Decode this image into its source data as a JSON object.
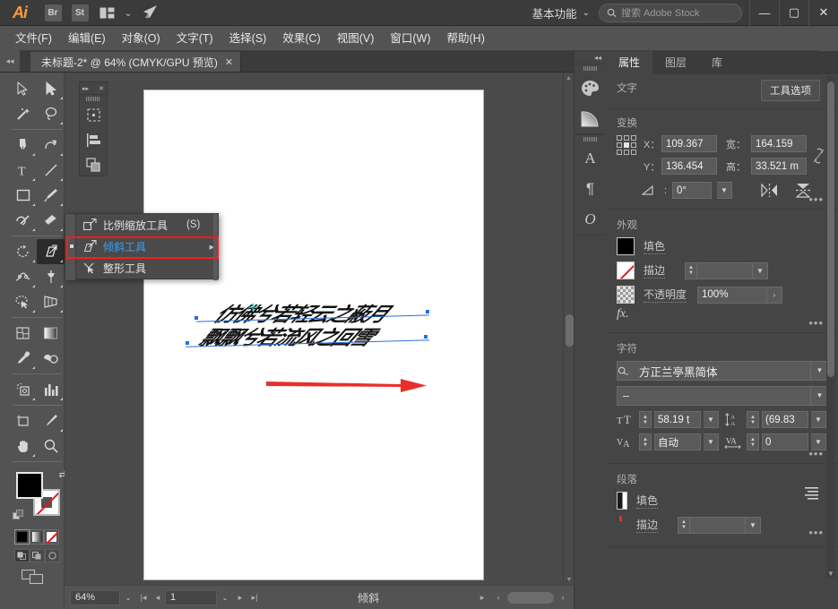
{
  "app": {
    "logo": "Ai",
    "bridge_label": "Br",
    "stock_label": "St",
    "arrange_icon": "arrange-icon",
    "caret": "⌄",
    "rocket_icon": "rocket-icon"
  },
  "topbar": {
    "workspace": "基本功能",
    "workspace_caret": "⌄",
    "search_placeholder": "搜索 Adobe Stock",
    "search_icon": "search-icon",
    "minimize": "—",
    "maximize": "▢",
    "close": "✕"
  },
  "menubar": {
    "items": [
      {
        "label": "文件(F)"
      },
      {
        "label": "编辑(E)"
      },
      {
        "label": "对象(O)"
      },
      {
        "label": "文字(T)"
      },
      {
        "label": "选择(S)"
      },
      {
        "label": "效果(C)"
      },
      {
        "label": "视图(V)"
      },
      {
        "label": "窗口(W)"
      },
      {
        "label": "帮助(H)"
      }
    ]
  },
  "tabbar": {
    "collapse_left": "◂◂",
    "collapse_right": "▸▸",
    "document": {
      "title": "未标题-2* @ 64% (CMYK/GPU 预览)",
      "close": "✕"
    }
  },
  "toolbar": {
    "collapse": "◂◂",
    "tools": [
      {
        "name": "selection-tool"
      },
      {
        "name": "direct-selection-tool"
      },
      {
        "name": "magic-wand-tool"
      },
      {
        "name": "lasso-tool"
      },
      {
        "name": "pen-tool"
      },
      {
        "name": "curvature-tool"
      },
      {
        "name": "type-tool"
      },
      {
        "name": "line-segment-tool"
      },
      {
        "name": "rectangle-tool"
      },
      {
        "name": "paintbrush-tool"
      },
      {
        "name": "shaper-tool"
      },
      {
        "name": "eraser-tool"
      },
      {
        "name": "rotate-tool"
      },
      {
        "name": "shear-tool"
      },
      {
        "name": "width-tool"
      },
      {
        "name": "free-transform-tool"
      },
      {
        "name": "shape-builder-tool"
      },
      {
        "name": "perspective-grid-tool"
      },
      {
        "name": "mesh-tool"
      },
      {
        "name": "gradient-tool"
      },
      {
        "name": "eyedropper-tool"
      },
      {
        "name": "blend-tool"
      },
      {
        "name": "symbol-sprayer-tool"
      },
      {
        "name": "column-graph-tool"
      },
      {
        "name": "artboard-tool"
      },
      {
        "name": "slice-tool"
      },
      {
        "name": "hand-tool"
      },
      {
        "name": "zoom-tool"
      }
    ],
    "active_tool": "shear-tool",
    "fill_color": "#000000",
    "stroke_color": "#ffffff",
    "stroke_none": true,
    "color_modes": [
      "color-swatch",
      "gradient-swatch",
      "none-swatch"
    ],
    "draw_modes": [
      "draw-normal",
      "draw-behind",
      "draw-inside"
    ],
    "screen_mode": "screen-mode-icon"
  },
  "mini_panel": {
    "expand": "▸▸",
    "close": "✕",
    "items": [
      {
        "name": "transform-panel-icon"
      },
      {
        "name": "align-panel-icon"
      },
      {
        "name": "pathfinder-panel-icon"
      }
    ]
  },
  "flyout_menu": {
    "items": [
      {
        "name": "scale-tool",
        "label": "比例缩放工具",
        "shortcut": "(S)",
        "selected": false,
        "has_submenu": false
      },
      {
        "name": "shear-tool",
        "label": "倾斜工具",
        "shortcut": "",
        "selected": true,
        "has_submenu": true
      },
      {
        "name": "reshape-tool",
        "label": "整形工具",
        "shortcut": "",
        "selected": false,
        "has_submenu": false
      }
    ],
    "highlight_color": "#ff1a1a",
    "selected_color": "#3aa0f5"
  },
  "canvas": {
    "artwork": {
      "line1": "仿佛兮若轻云之蔽月",
      "line2": "飘飘兮若流风之回雪"
    },
    "annotation_arrow_color": "#e8302a",
    "selection_color": "#2a6fd6",
    "center_mark": "center-point-icon"
  },
  "statusbar": {
    "zoom": "64%",
    "zoom_caret": "⌄",
    "first_page": "|◂",
    "prev_page": "◂",
    "page": "1",
    "page_caret": "⌄",
    "next_page": "▸",
    "last_page": "▸|",
    "status_text": "倾斜",
    "play": "▸",
    "scroll_left": "‹",
    "scroll_right": "›"
  },
  "right_strip": {
    "collapse": "◂◂",
    "icons": [
      {
        "name": "color-panel-icon",
        "glyph": "color-wheel"
      },
      {
        "name": "gradient-panel-icon",
        "glyph": "gradient-quarter"
      },
      {
        "name": "character-panel-icon",
        "glyph": "A"
      },
      {
        "name": "paragraph-panel-icon",
        "glyph": "¶"
      },
      {
        "name": "opentype-panel-icon",
        "glyph": "O"
      }
    ]
  },
  "properties": {
    "tabs": [
      {
        "label": "属性",
        "active": true
      },
      {
        "label": "图层",
        "active": false
      },
      {
        "label": "库",
        "active": false
      }
    ],
    "type_section": {
      "title": "文字",
      "tool_options_button": "工具选项"
    },
    "transform": {
      "title": "变换",
      "x_label": "X：",
      "x_value": "109.367",
      "y_label": "Y：",
      "y_value": "136.454",
      "w_label": "宽：",
      "w_value": "164.159",
      "h_label": "高：",
      "h_value": "33.521 m",
      "link_icon": "link-broken-icon",
      "angle_label": "angle-icon",
      "angle_value": "0°",
      "flip_h": "flip-horizontal-icon",
      "flip_v": "flip-vertical-icon",
      "more": "•••"
    },
    "appearance": {
      "title": "外观",
      "fill_label": "填色",
      "fill_color": "#000000",
      "stroke_label": "描边",
      "stroke_value": "",
      "opacity_label": "不透明度",
      "opacity_value": "100%",
      "opacity_arrow": "›",
      "fx_label": "fx.",
      "more": "•••"
    },
    "character": {
      "title": "字符",
      "font_family": "方正兰亭黑简体",
      "font_style": "–",
      "size_value": "58.19 ṭ",
      "leading_value": "(69.83",
      "kerning_value": "自动",
      "tracking_value": "0",
      "size_icon": "font-size-icon",
      "leading_icon": "leading-icon",
      "kerning_icon": "kerning-icon",
      "tracking_icon": "tracking-icon",
      "search_icon": "font-search-icon",
      "more": "•••"
    },
    "paragraph": {
      "title": "段落",
      "fill_label": "填色",
      "stroke_label": "描边",
      "align_icon": "align-text-icon",
      "more": "•••"
    }
  }
}
